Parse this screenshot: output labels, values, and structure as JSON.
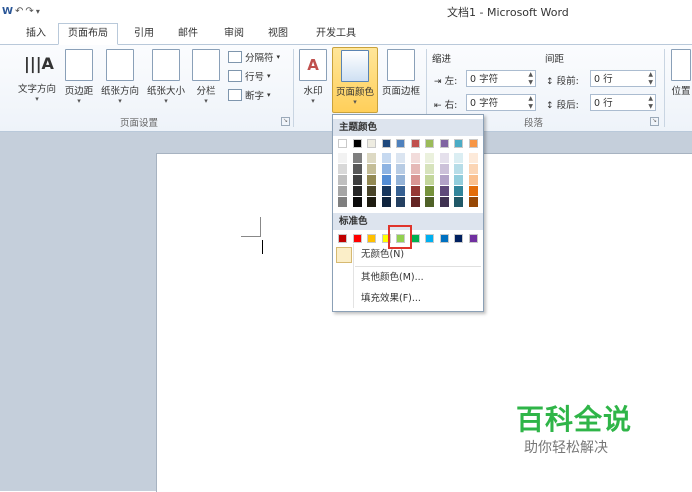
{
  "titlebar": {
    "qat_save": "W",
    "qat_undo": "↶",
    "qat_redo": "↷",
    "title": "文档1 - Microsoft Word"
  },
  "tabs": {
    "items": [
      {
        "label": "插入"
      },
      {
        "label": "页面布局",
        "active": true
      },
      {
        "label": "引用"
      },
      {
        "label": "邮件"
      },
      {
        "label": "审阅"
      },
      {
        "label": "视图"
      },
      {
        "label": "开发工具"
      }
    ]
  },
  "ribbon": {
    "page_setup": {
      "text_direction": "文字方向",
      "margins": "页边距",
      "orientation": "纸张方向",
      "size": "纸张大小",
      "columns": "分栏",
      "breaks": "分隔符",
      "line_numbers": "行号",
      "hyphenation": "断字",
      "group_label": "页面设置"
    },
    "page_background": {
      "watermark": "水印",
      "page_color": "页面颜色",
      "page_borders": "页面边框"
    },
    "paragraph": {
      "indent_label": "缩进",
      "left_label": "左:",
      "left_value": "0 字符",
      "right_label": "右:",
      "right_value": "0 字符",
      "spacing_label": "间距",
      "before_label": "段前:",
      "before_value": "0 行",
      "after_label": "段后:",
      "after_value": "0 行",
      "group_label": "段落"
    },
    "position": "位置"
  },
  "dropdown": {
    "theme_colors_header": "主题颜色",
    "standard_colors_header": "标准色",
    "no_color": "无颜色(N)",
    "more_colors": "其他颜色(M)...",
    "fill_effects": "填充效果(F)...",
    "theme_top_row": [
      "#ffffff",
      "#000000",
      "#eeece1",
      "#1f497d",
      "#4f81bd",
      "#c0504d",
      "#9bbb59",
      "#8064a2",
      "#4bacc6",
      "#f79646"
    ],
    "theme_shades": [
      [
        "#f2f2f2",
        "#7f7f7f",
        "#ddd9c3",
        "#c6d9f0",
        "#dbe5f1",
        "#f2dcdb",
        "#ebf1dd",
        "#e5e0ec",
        "#dbeef3",
        "#fdeada"
      ],
      [
        "#d8d8d8",
        "#595959",
        "#c4bd97",
        "#8db3e2",
        "#b8cce4",
        "#e5b9b7",
        "#d7e3bc",
        "#ccc1d9",
        "#b7dde8",
        "#fbd5b5"
      ],
      [
        "#bfbfbf",
        "#3f3f3f",
        "#938953",
        "#548dd4",
        "#95b3d7",
        "#d99694",
        "#c3d69b",
        "#b2a2c7",
        "#92cddc",
        "#fac08f"
      ],
      [
        "#a5a5a5",
        "#262626",
        "#494429",
        "#17365d",
        "#366092",
        "#953734",
        "#76923c",
        "#5f497a",
        "#31859b",
        "#e36c09"
      ],
      [
        "#7f7f7f",
        "#0c0c0c",
        "#1d1b10",
        "#0f243e",
        "#244061",
        "#632423",
        "#4f6128",
        "#3f3151",
        "#205867",
        "#974806"
      ]
    ],
    "standard": [
      "#c00000",
      "#ff0000",
      "#ffc000",
      "#ffff00",
      "#92d050",
      "#00b050",
      "#00b0f0",
      "#0070c0",
      "#002060",
      "#7030a0"
    ],
    "selected_standard_index": 4
  },
  "watermark": {
    "main": "百科全说",
    "sub": "助你轻松解决"
  }
}
